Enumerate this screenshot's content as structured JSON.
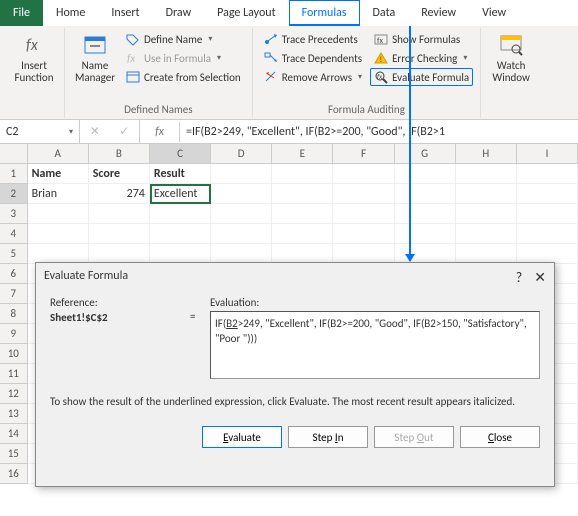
{
  "tabs": {
    "file": "File",
    "home": "Home",
    "insert": "Insert",
    "draw": "Draw",
    "page": "Page Layout",
    "formulas": "Formulas",
    "data": "Data",
    "review": "Review",
    "view": "View"
  },
  "ribbon": {
    "insertFn": "Insert Function",
    "nameMgr": "Name Manager",
    "defName": "Define Name",
    "useIn": "Use in Formula",
    "createSel": "Create from Selection",
    "groupDefined": "Defined Names",
    "tracePrec": "Trace Precedents",
    "traceDep": "Trace Dependents",
    "removeArr": "Remove Arrows",
    "showFm": "Show Formulas",
    "errChk": "Error Checking",
    "evalFm": "Evaluate Formula",
    "groupAudit": "Formula Auditing",
    "watch": "Watch Window"
  },
  "nameBox": "C2",
  "formula": "=IF(B2>249, \"Excellent\", IF(B2>=200, \"Good\", IF(B2>1",
  "chart_data": {
    "type": "table",
    "headers": [
      "Name",
      "Score",
      "Result"
    ],
    "rows": [
      [
        "Brian",
        274,
        "Excellent"
      ]
    ]
  },
  "dlg": {
    "title": "Evaluate Formula",
    "refLabel": "Reference:",
    "ref": "Sheet1!$C$2",
    "evalLabel": "Evaluation:",
    "evalPrefix": "IF(",
    "evalUnder": "B2",
    "evalRest": ">249, \"Excellent\", IF(B2>=200, \"Good\", IF(B2>150, \"Satisfactory\", \"Poor \")))",
    "msg": "To show the result of the underlined expression, click Evaluate.  The most recent result appears italicized.",
    "btnEval": "Evaluate",
    "btnStepIn": "Step In",
    "btnStepOut": "Step Out",
    "btnClose": "Close"
  }
}
